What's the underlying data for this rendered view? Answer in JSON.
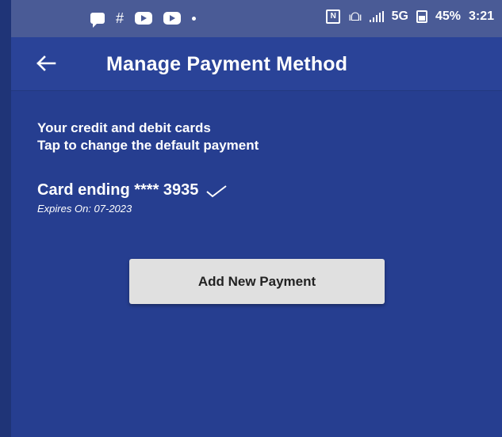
{
  "status_bar": {
    "left_icons": [
      "chat-icon",
      "slack-icon",
      "youtube-icon",
      "youtube-icon",
      "dot-icon"
    ],
    "right_icons": [
      "nfc-icon",
      "vibrate-icon",
      "signal-icon",
      "battery-icon"
    ],
    "network": "5G",
    "battery": "45%",
    "time": "3:21"
  },
  "app_bar": {
    "back_icon": "arrow-left-icon",
    "title": "Manage Payment Method"
  },
  "intro": {
    "line1": "Your credit and debit cards",
    "line2": "Tap to change the default payment"
  },
  "card": {
    "label": "Card ending **** 3935",
    "expiry": "Expires On: 07-2023",
    "default_icon": "check-icon"
  },
  "add_button": {
    "label": "Add New Payment"
  },
  "colors": {
    "background": "#263e90",
    "app_bar": "#2a4398",
    "status_bar": "#4a5b96",
    "button": "#e0e0e0"
  }
}
